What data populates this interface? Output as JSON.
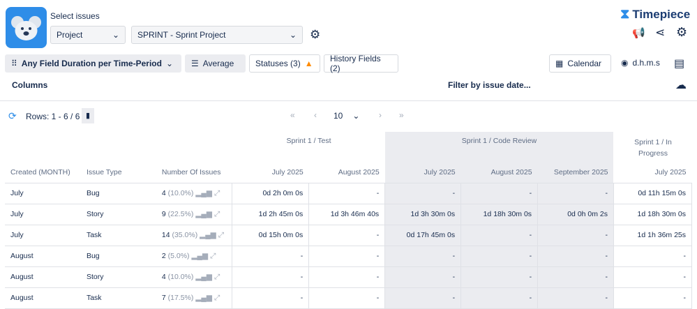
{
  "header": {
    "select_label": "Select issues",
    "project_dropdown": "Project",
    "sprint_dropdown": "SPRINT - Sprint Project",
    "brand": "Timepiece"
  },
  "toolbar": {
    "report_type": "Any Field Duration per Time-Period",
    "average": "Average",
    "statuses": "Statuses (3)",
    "history_fields": "History Fields (2)",
    "calendar": "Calendar",
    "time_format": "d.h.m.s"
  },
  "bar2": {
    "columns": "Columns",
    "filter": "Filter by issue date..."
  },
  "pager": {
    "rows": "Rows: 1 - 6 / 6",
    "page_size": "10"
  },
  "groups": [
    {
      "label": "Sprint 1 / Test"
    },
    {
      "label": "Sprint 1 / Code Review"
    },
    {
      "label": "Sprint 1 / In Progress"
    }
  ],
  "columns": [
    "Created (MONTH)",
    "Issue Type",
    "Number Of Issues",
    "July 2025",
    "August 2025",
    "July 2025",
    "August 2025",
    "September 2025",
    "July 2025"
  ],
  "rows": [
    {
      "month": "July",
      "type": "Bug",
      "count": "4",
      "pct": "(10.0%)",
      "cells": [
        "0d 2h 0m 0s",
        "-",
        "-",
        "-",
        "-",
        "0d 11h 15m 0s"
      ]
    },
    {
      "month": "July",
      "type": "Story",
      "count": "9",
      "pct": "(22.5%)",
      "cells": [
        "1d 2h 45m 0s",
        "1d 3h 46m 40s",
        "1d 3h 30m 0s",
        "1d 18h 30m 0s",
        "0d 0h 0m 2s",
        "1d 18h 30m 0s"
      ]
    },
    {
      "month": "July",
      "type": "Task",
      "count": "14",
      "pct": "(35.0%)",
      "cells": [
        "0d 15h 0m 0s",
        "-",
        "0d 17h 45m 0s",
        "-",
        "-",
        "1d 1h 36m 25s"
      ]
    },
    {
      "month": "August",
      "type": "Bug",
      "count": "2",
      "pct": "(5.0%)",
      "cells": [
        "-",
        "-",
        "-",
        "-",
        "-",
        "-"
      ]
    },
    {
      "month": "August",
      "type": "Story",
      "count": "4",
      "pct": "(10.0%)",
      "cells": [
        "-",
        "-",
        "-",
        "-",
        "-",
        "-"
      ]
    },
    {
      "month": "August",
      "type": "Task",
      "count": "7",
      "pct": "(17.5%)",
      "cells": [
        "-",
        "-",
        "-",
        "-",
        "-",
        "-"
      ]
    }
  ],
  "colors": {
    "accent": "#2e8de8",
    "brand": "#1b3c72",
    "shade": "#ebecf0",
    "warning": "#ff8b00"
  }
}
